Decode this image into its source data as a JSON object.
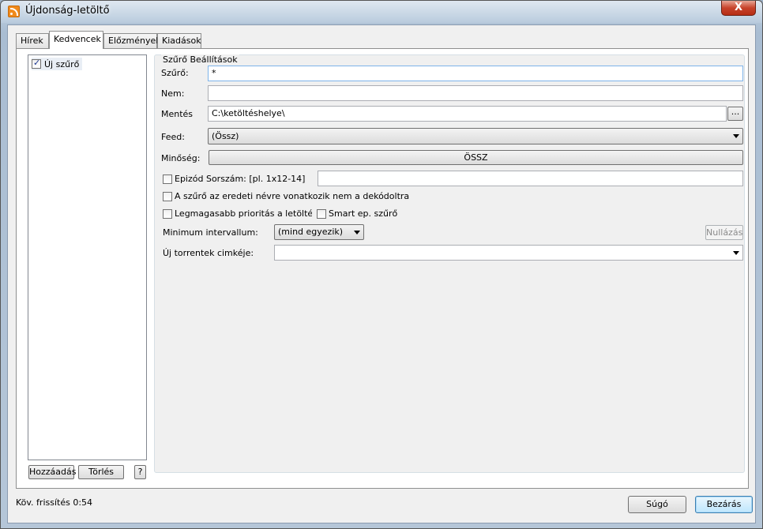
{
  "window": {
    "title": "Újdonság-letöltő",
    "close_symbol": "X"
  },
  "tabs": [
    {
      "label": "Hírek"
    },
    {
      "label": "Kedvencek"
    },
    {
      "label": "Előzmények"
    },
    {
      "label": "Kiadások"
    }
  ],
  "filters": {
    "items": [
      {
        "label": "Új szűrő",
        "checked": true
      }
    ],
    "add_label": "Hozzáadás",
    "delete_label": "Törlés",
    "help_label": "?"
  },
  "settings": {
    "group_title": "Szűrő Beállítások",
    "filter_label": "Szűrő:",
    "filter_value": "*",
    "not_label": "Nem:",
    "not_value": "",
    "save_label": "Mentés",
    "save_value": "C:\\ketöltéshelye\\",
    "browse_label": "...",
    "feed_label": "Feed:",
    "feed_value": "(Össz)",
    "quality_label": "Minőség:",
    "quality_value": "ÖSSZ",
    "episode_label": "Epizód Sorszám: [pl. 1x12-14]",
    "episode_value": "",
    "decoded_label": "A szűrő az eredeti névre vonatkozik nem a dekódoltra",
    "priority_label": "Legmagasabb prioritás a letöltésekre",
    "smart_label": "Smart ep. szűrő",
    "min_interval_label": "Minimum intervallum:",
    "min_interval_value": "(mind egyezik)",
    "reset_label": "Nullázás",
    "torrent_label_label": "Új torrentek cimkéje:",
    "torrent_label_value": ""
  },
  "footer": {
    "status": "Köv. frissítés 0:54",
    "help_label": "Súgó",
    "close_label": "Bezárás"
  }
}
